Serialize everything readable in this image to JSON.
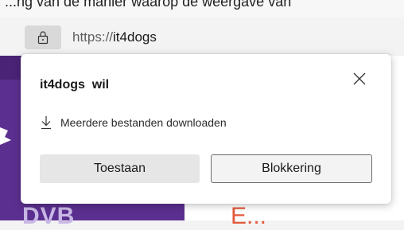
{
  "header_partial_text": "...ng van de manier waarop de weergave van",
  "address_bar": {
    "url_scheme": "https://",
    "url_host": "it4dogs"
  },
  "popup": {
    "title": "it4dogs  wil",
    "permission_label": "Meerdere bestanden downloaden",
    "allow_label": "Toestaan",
    "block_label": "Blokkering"
  },
  "page_backdrop": {
    "left_text": "DVB",
    "right_text": "E..."
  },
  "icons": {
    "lock": "lock-icon",
    "close": "close-icon",
    "download": "download-icon"
  },
  "colors": {
    "purple": "#5b2f8f",
    "accent_orange": "#e25a3c"
  }
}
